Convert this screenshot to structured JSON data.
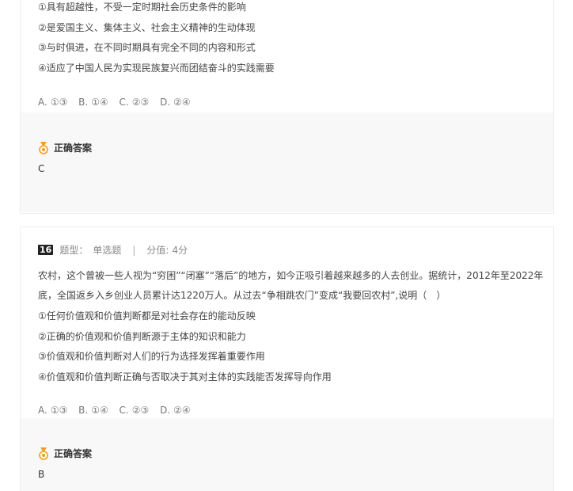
{
  "question_prev": {
    "statements": [
      "①具有超越性，不受一定时期社会历史条件的影响",
      "②是爱国主义、集体主义、社会主义精神的生动体现",
      "③与时俱进，在不同时期具有完全不同的内容和形式",
      "④适应了中国人民为实现民族复兴而团结奋斗的实践需要"
    ],
    "options": [
      {
        "letter": "A.",
        "text": "①③"
      },
      {
        "letter": "B.",
        "text": "①④"
      },
      {
        "letter": "C.",
        "text": "②③"
      },
      {
        "letter": "D.",
        "text": "②④"
      }
    ],
    "answer_label": "正确答案",
    "answer": "C"
  },
  "question_16": {
    "number": "16",
    "type_label": "题型：",
    "type": "单选题",
    "separator": "|",
    "score_label": "分值:",
    "score": "4分",
    "stem": "农村，这个曾被一些人视为“穷困”“闭塞”“落后”的地方，如今正吸引着越来越多的人去创业。据统计，2012年至2022年底，全国返乡入乡创业人员累计达1220万人。从过去“争相跳农门”变成“我要回农村”,说明（　）",
    "statements": [
      "①任何价值观和价值判断都是对社会存在的能动反映",
      "②正确的价值观和价值判断源于主体的知识和能力",
      "③价值观和价值判断对人们的行为选择发挥着重要作用",
      "④价值观和价值判断正确与否取决于其对主体的实践能否发挥导向作用"
    ],
    "options": [
      {
        "letter": "A.",
        "text": "①③"
      },
      {
        "letter": "B.",
        "text": "①④"
      },
      {
        "letter": "C.",
        "text": "②③"
      },
      {
        "letter": "D.",
        "text": "②④"
      }
    ],
    "answer_label": "正确答案",
    "answer": "B"
  },
  "colors": {
    "accent_medal": "#f0a020",
    "answer_bg": "#f8f8f8",
    "badge_bg": "#222222"
  }
}
